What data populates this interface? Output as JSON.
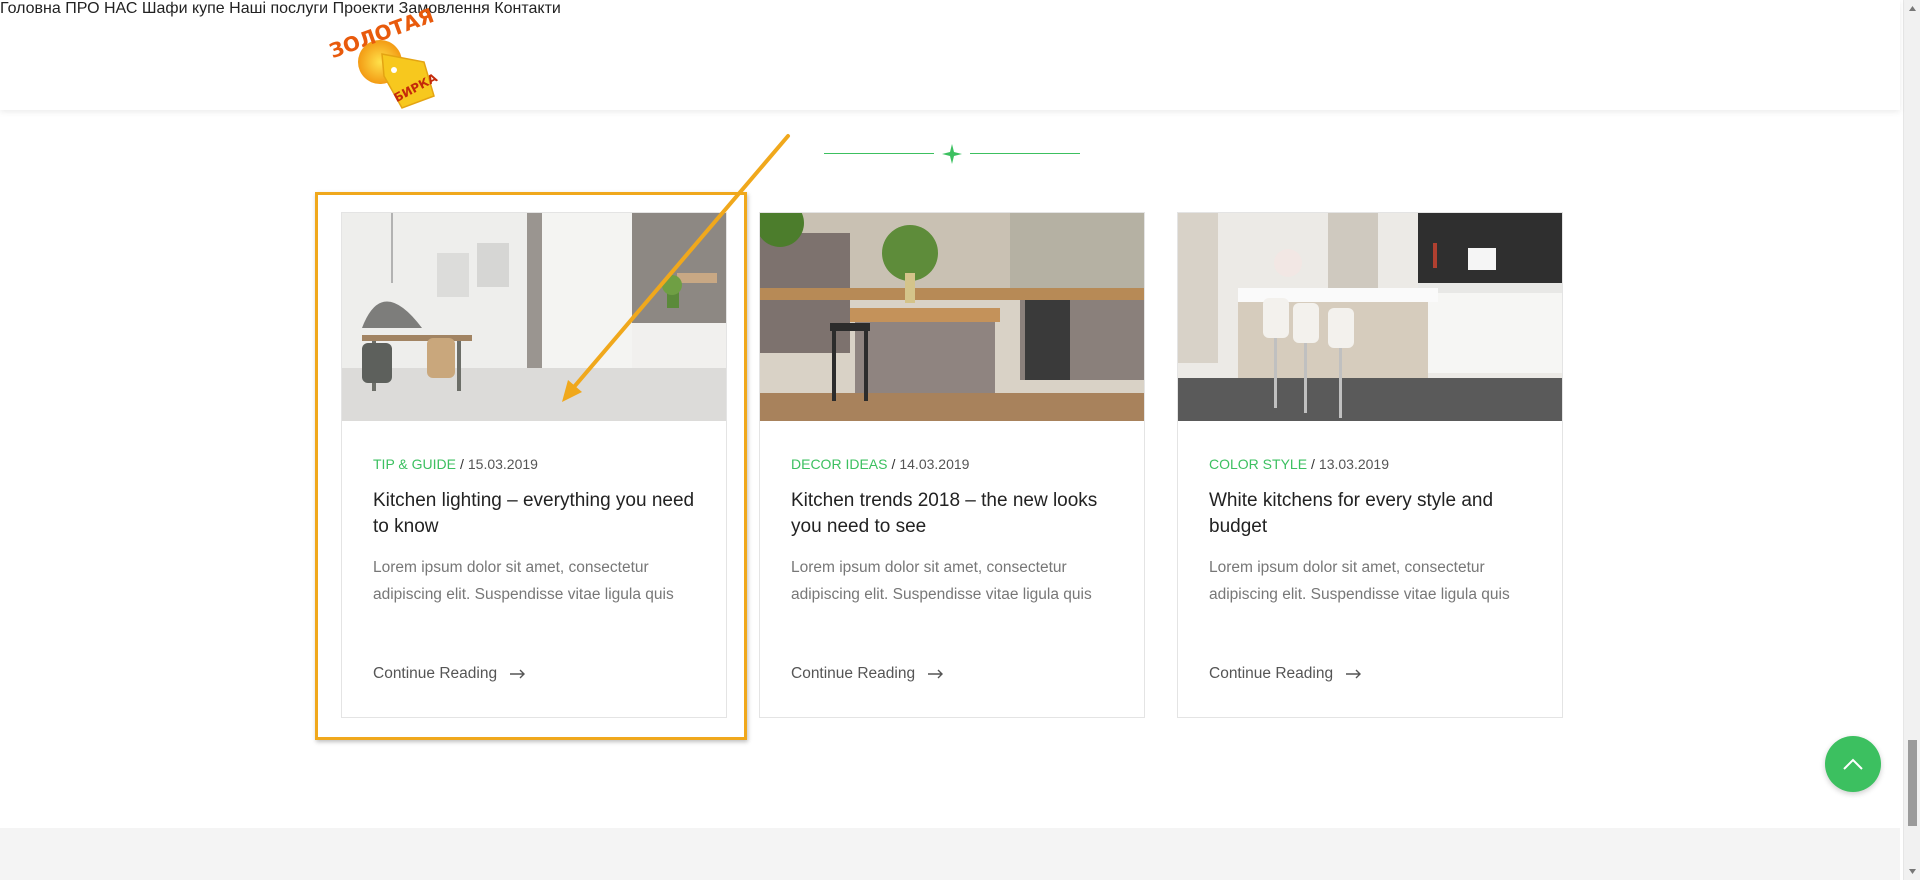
{
  "brand": {
    "logo_text": "ЗОЛОТАЯ БИРКА"
  },
  "nav": {
    "items": [
      "Головна",
      "ПРО НАС",
      "Шафи купе",
      "Наші послуги",
      "Проекти",
      "Замовлення",
      "Контакти"
    ]
  },
  "posts": [
    {
      "category": "TIP & GUIDE",
      "date": "15.03.2019",
      "title": "Kitchen lighting – everything you need to know",
      "excerpt": "Lorem ipsum dolor sit amet, consectetur adipiscing elit. Suspendisse vitae ligula quis",
      "more": "Continue Reading"
    },
    {
      "category": "DECOR IDEAS",
      "date": "14.03.2019",
      "title": "Kitchen trends 2018 – the new looks you need to see",
      "excerpt": "Lorem ipsum dolor sit amet, consectetur adipiscing elit. Suspendisse vitae ligula quis",
      "more": "Continue Reading"
    },
    {
      "category": "COLOR STYLE",
      "date": "13.03.2019",
      "title": "White kitchens for every style and budget",
      "excerpt": "Lorem ipsum dolor sit amet, consectetur adipiscing elit. Suspendisse vitae ligula quis",
      "more": "Continue Reading"
    }
  ],
  "meta_separator": "/",
  "icons": {
    "divider": "sparkle-icon",
    "more": "arrow-right-icon",
    "to_top": "chevron-up-icon"
  },
  "colors": {
    "accent": "#3cc060",
    "highlight": "#f0a81c",
    "text": "#222222",
    "muted": "#777777"
  }
}
